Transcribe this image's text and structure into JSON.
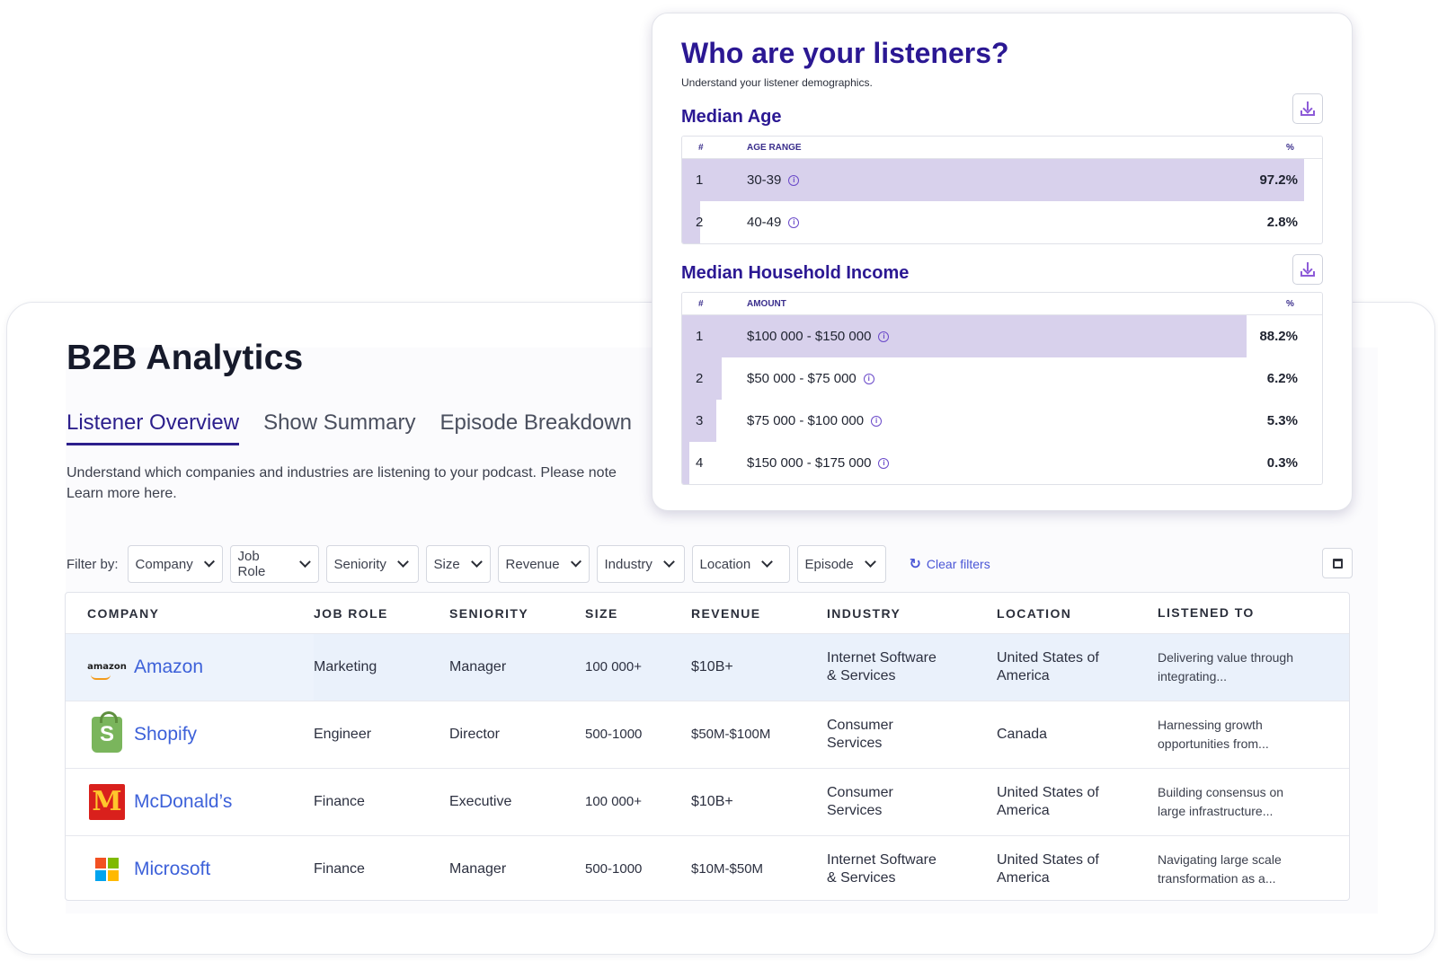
{
  "page": {
    "title": "B2B Analytics",
    "tabs": [
      "Listener Overview",
      "Show Summary",
      "Episode Breakdown"
    ],
    "intro_line1": "Understand which companies and industries are listening to your podcast. Please note",
    "intro_line2": "Learn more here."
  },
  "filters": {
    "label": "Filter by:",
    "items": [
      "Company",
      "Job Role",
      "Seniority",
      "Size",
      "Revenue",
      "Industry",
      "Location",
      "Episode"
    ],
    "clear": "Clear filters"
  },
  "table": {
    "headers": [
      "COMPANY",
      "JOB ROLE",
      "SENIORITY",
      "SIZE",
      "REVENUE",
      "INDUSTRY",
      "LOCATION",
      "LISTENED TO"
    ],
    "rows": [
      {
        "company": "Amazon",
        "logo": "amazon",
        "role": "Marketing",
        "seniority": "Manager",
        "size": "100 000+",
        "revenue": "$10B+",
        "industry_1": "Internet Software",
        "industry_2": "& Services",
        "location_1": "United States of",
        "location_2": "America",
        "listened_1": "Delivering value through",
        "listened_2": "integrating..."
      },
      {
        "company": "Shopify",
        "logo": "shopify",
        "role": "Engineer",
        "seniority": "Director",
        "size": "500-1000",
        "revenue": "$50M-$100M",
        "industry_1": "Consumer",
        "industry_2": "Services",
        "location_1": "Canada",
        "location_2": "",
        "listened_1": "Harnessing growth",
        "listened_2": "opportunities from..."
      },
      {
        "company": "McDonald’s",
        "logo": "mcdonalds",
        "role": "Finance",
        "seniority": "Executive",
        "size": "100 000+",
        "revenue": "$10B+",
        "industry_1": "Consumer",
        "industry_2": "Services",
        "location_1": "United States of",
        "location_2": "America",
        "listened_1": "Building consensus on",
        "listened_2": "large infrastructure..."
      },
      {
        "company": "Microsoft",
        "logo": "microsoft",
        "role": "Finance",
        "seniority": "Manager",
        "size": "500-1000",
        "revenue": "$10M-$50M",
        "industry_1": "Internet Software",
        "industry_2": "& Services",
        "location_1": "United States of",
        "location_2": "America",
        "listened_1": "Navigating large scale",
        "listened_2": "transformation as a..."
      }
    ]
  },
  "demographics": {
    "title": "Who are your listeners?",
    "subtitle": "Understand your listener demographics.",
    "age": {
      "title": "Median Age",
      "col_num": "#",
      "col_label": "AGE RANGE",
      "col_pct": "%",
      "rows": [
        {
          "num": "1",
          "label": "30-39",
          "pct": "97.2%",
          "share": 0.972
        },
        {
          "num": "2",
          "label": "40-49",
          "pct": "2.8%",
          "share": 0.028
        }
      ]
    },
    "income": {
      "title": "Median Household Income",
      "col_num": "#",
      "col_label": "AMOUNT",
      "col_pct": "%",
      "rows": [
        {
          "num": "1",
          "label": "$100 000 - $150 000",
          "pct": "88.2%",
          "share": 0.882
        },
        {
          "num": "2",
          "label": "$50 000 - $75 000",
          "pct": "6.2%",
          "share": 0.062
        },
        {
          "num": "3",
          "label": "$75 000 - $100 000",
          "pct": "5.3%",
          "share": 0.053
        },
        {
          "num": "4",
          "label": "$150 000 - $175 000",
          "pct": "0.3%",
          "share": 0.003
        }
      ]
    }
  }
}
